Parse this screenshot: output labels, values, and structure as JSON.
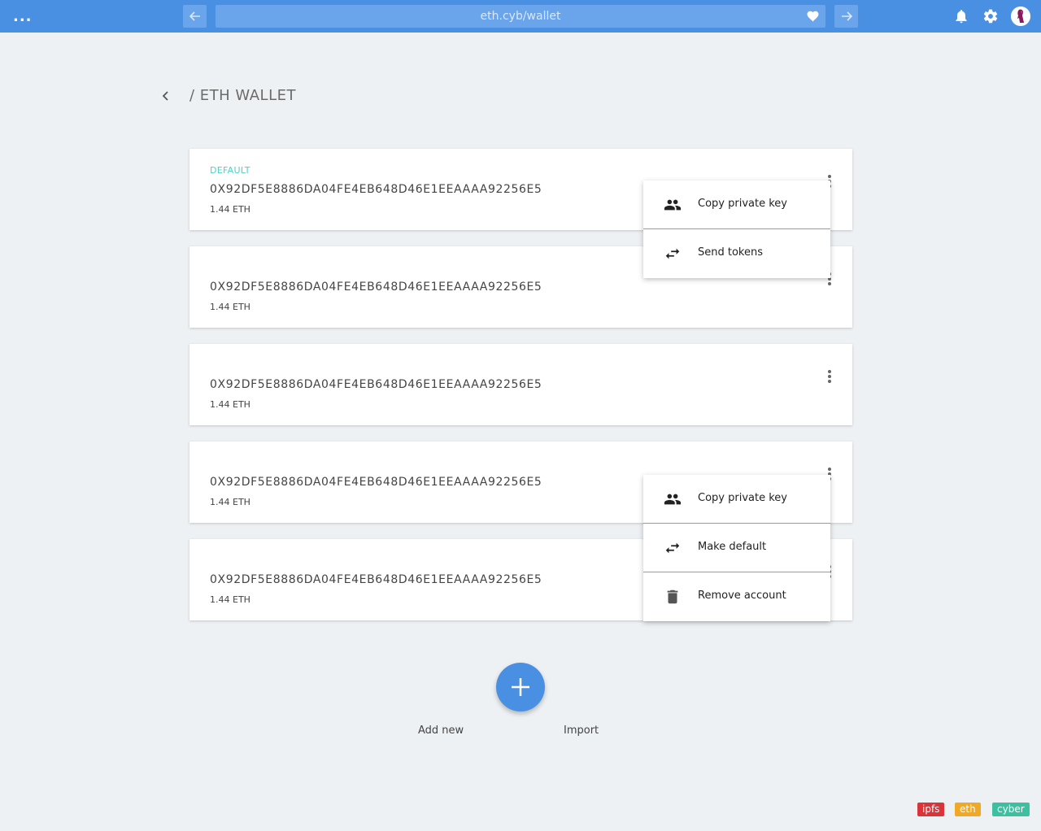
{
  "topbar": {
    "menu_glyph": "...",
    "url": "eth.cyb/wallet",
    "icons": [
      "arrow-left-icon",
      "heart-icon",
      "arrow-right-icon",
      "bell-icon",
      "gear-icon",
      "avatar"
    ],
    "accent_color": "#4a90e2"
  },
  "header": {
    "title": "/ ETH  WALLET"
  },
  "accounts": [
    {
      "badge": "DEFAULT",
      "address": "0X92DF5E8886DA04FE4EB648D46E1EEAAAA92256E5",
      "balance": "1.44 ETH"
    },
    {
      "badge": "",
      "address": "0X92DF5E8886DA04FE4EB648D46E1EEAAAA92256E5",
      "balance": "1.44 ETH"
    },
    {
      "badge": "",
      "address": "0X92DF5E8886DA04FE4EB648D46E1EEAAAA92256E5",
      "balance": "1.44 ETH"
    },
    {
      "badge": "",
      "address": "0X92DF5E8886DA04FE4EB648D46E1EEAAAA92256E5",
      "balance": "1.44 ETH"
    },
    {
      "badge": "",
      "address": "0X92DF5E8886DA04FE4EB648D46E1EEAAAA92256E5",
      "balance": "1.44 ETH"
    }
  ],
  "menu_default": {
    "items": [
      {
        "label": "Copy private key",
        "icon": "people-icon"
      },
      {
        "label": "Send tokens",
        "icon": "swap-arrows-icon"
      }
    ]
  },
  "menu_other": {
    "items": [
      {
        "label": "Copy private key",
        "icon": "people-icon"
      },
      {
        "label": "Make default",
        "icon": "swap-arrows-icon"
      },
      {
        "label": "Remove account",
        "icon": "trash-icon"
      }
    ]
  },
  "actions": {
    "add_new": "Add new",
    "import": "Import"
  },
  "footer_tags": [
    {
      "label": "ipfs",
      "color": "#d9343a"
    },
    {
      "label": "eth",
      "color": "#f0a825"
    },
    {
      "label": "cyber",
      "color": "#3cc0a0"
    }
  ]
}
